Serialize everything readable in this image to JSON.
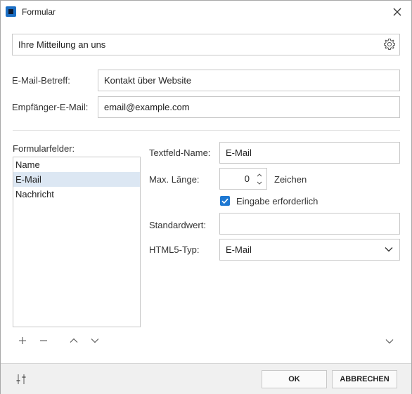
{
  "window": {
    "title": "Formular"
  },
  "form_title": {
    "value": "Ihre Mitteilung an uns"
  },
  "subject": {
    "label": "E-Mail-Betreff:",
    "value": "Kontakt über Website"
  },
  "recipient": {
    "label": "Empfänger-E-Mail:",
    "value": "email@example.com"
  },
  "fields": {
    "label": "Formularfelder:",
    "items": [
      "Name",
      "E-Mail",
      "Nachricht"
    ],
    "selected": "E-Mail"
  },
  "details": {
    "name_label": "Textfeld-Name:",
    "name_value": "E-Mail",
    "maxlen_label": "Max. Länge:",
    "maxlen_value": "0",
    "maxlen_unit": "Zeichen",
    "required_label": "Eingabe erforderlich",
    "required_checked": true,
    "default_label": "Standardwert:",
    "default_value": "",
    "html5_label": "HTML5-Typ:",
    "html5_value": "E-Mail"
  },
  "footer": {
    "ok_label": "OK",
    "cancel_label": "ABBRECHEN"
  },
  "colors": {
    "accent": "#1e78d2",
    "selection": "#dce7f3",
    "footer_bg": "#f0f0f0"
  },
  "icons": [
    "app-icon",
    "close-icon",
    "gear-icon",
    "add-icon",
    "remove-icon",
    "move-up-icon",
    "move-down-icon",
    "expand-icon",
    "settings-sliders-icon",
    "checkmark-icon",
    "chevron-down-icon"
  ]
}
